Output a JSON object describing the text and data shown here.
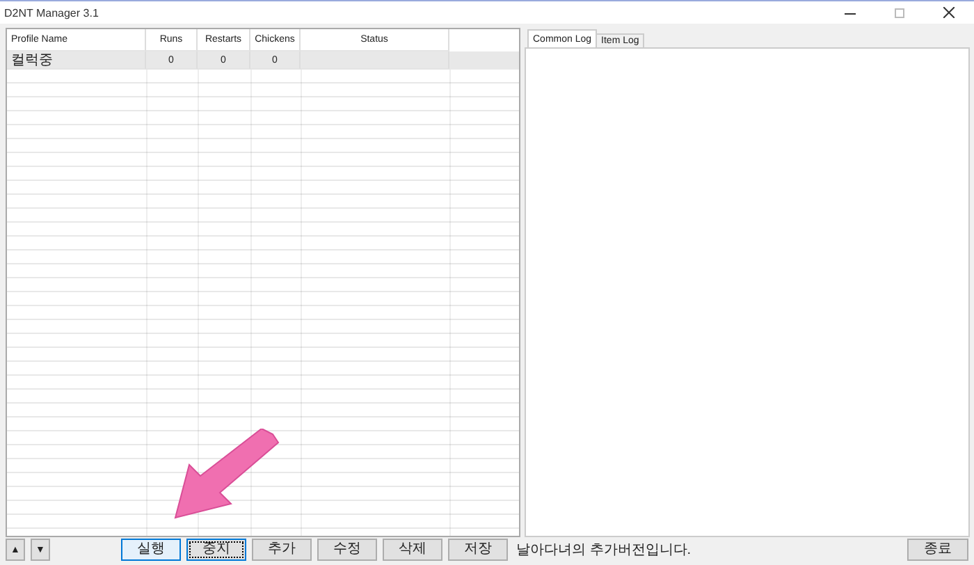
{
  "window": {
    "title": "D2NT Manager 3.1"
  },
  "table": {
    "columns": [
      "Profile Name",
      "Runs",
      "Restarts",
      "Chickens",
      "Status"
    ],
    "rows": [
      {
        "cells": [
          "컬럭중",
          "0",
          "0",
          "0"
        ],
        "selected": true
      }
    ]
  },
  "log_tabs": [
    {
      "label": "Common Log",
      "selected": true
    },
    {
      "label": "Item Log",
      "selected": false
    }
  ],
  "move_buttons": [
    "▲",
    "▼"
  ],
  "action_buttons": [
    {
      "label": "실행",
      "hovered": true,
      "focused": false
    },
    {
      "label": "중지",
      "hovered": false,
      "focused": true
    },
    {
      "label": "추가",
      "hovered": false,
      "focused": false
    },
    {
      "label": "수정",
      "hovered": false,
      "focused": false
    },
    {
      "label": "삭제",
      "hovered": false,
      "focused": false
    },
    {
      "label": "저장",
      "hovered": false,
      "focused": false
    }
  ],
  "status_text": "날아다녀의 추가버전입니다.",
  "exit_button": "종료"
}
